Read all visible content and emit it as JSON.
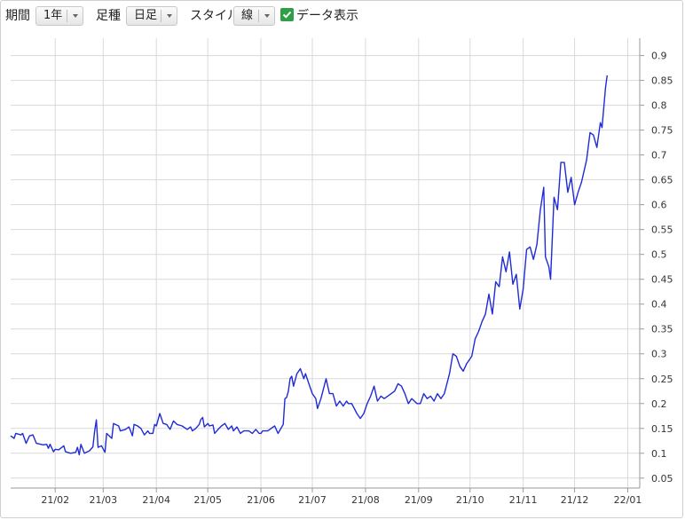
{
  "toolbar": {
    "period_label": "期間",
    "period_value": "1年",
    "candle_label": "足種",
    "candle_value": "日足",
    "style_label": "スタイル",
    "style_value": "線",
    "data_label": "データ表示",
    "data_checked": true
  },
  "chart_data": {
    "type": "line",
    "title": "",
    "xlabel": "",
    "ylabel": "",
    "ylim": [
      0.03,
      0.935
    ],
    "y_ticks": [
      "0.05",
      "0.1",
      "0.15",
      "0.2",
      "0.25",
      "0.3",
      "0.35",
      "0.4",
      "0.45",
      "0.5",
      "0.55",
      "0.6",
      "0.65",
      "0.7",
      "0.75",
      "0.8",
      "0.85",
      "0.9"
    ],
    "x_ticks": [
      {
        "label": "21/02",
        "date": "2021-02-01"
      },
      {
        "label": "21/03",
        "date": "2021-03-01"
      },
      {
        "label": "21/04",
        "date": "2021-04-01"
      },
      {
        "label": "21/05",
        "date": "2021-05-01"
      },
      {
        "label": "21/06",
        "date": "2021-06-01"
      },
      {
        "label": "21/07",
        "date": "2021-07-01"
      },
      {
        "label": "21/08",
        "date": "2021-08-01"
      },
      {
        "label": "21/09",
        "date": "2021-09-01"
      },
      {
        "label": "21/10",
        "date": "2021-10-01"
      },
      {
        "label": "21/11",
        "date": "2021-11-01"
      },
      {
        "label": "21/12",
        "date": "2021-12-01"
      },
      {
        "label": "22/01",
        "date": "2022-01-01"
      }
    ],
    "xlim": [
      "2021-01-06",
      "2022-01-08"
    ],
    "grid": true,
    "line_color": "#1f2bd6",
    "series": [
      {
        "points": [
          [
            "2021-01-06",
            0.135
          ],
          [
            "2021-01-08",
            0.13
          ],
          [
            "2021-01-09",
            0.14
          ],
          [
            "2021-01-12",
            0.137
          ],
          [
            "2021-01-13",
            0.14
          ],
          [
            "2021-01-15",
            0.12
          ],
          [
            "2021-01-17",
            0.135
          ],
          [
            "2021-01-19",
            0.137
          ],
          [
            "2021-01-21",
            0.12
          ],
          [
            "2021-01-25",
            0.117
          ],
          [
            "2021-01-27",
            0.118
          ],
          [
            "2021-01-28",
            0.11
          ],
          [
            "2021-01-29",
            0.118
          ],
          [
            "2021-01-31",
            0.103
          ],
          [
            "2021-02-01",
            0.108
          ],
          [
            "2021-02-03",
            0.107
          ],
          [
            "2021-02-06",
            0.115
          ],
          [
            "2021-02-07",
            0.103
          ],
          [
            "2021-02-10",
            0.1
          ],
          [
            "2021-02-13",
            0.102
          ],
          [
            "2021-02-14",
            0.112
          ],
          [
            "2021-02-15",
            0.097
          ],
          [
            "2021-02-16",
            0.118
          ],
          [
            "2021-02-18",
            0.1
          ],
          [
            "2021-02-21",
            0.105
          ],
          [
            "2021-02-23",
            0.113
          ],
          [
            "2021-02-24",
            0.145
          ],
          [
            "2021-02-25",
            0.167
          ],
          [
            "2021-02-26",
            0.112
          ],
          [
            "2021-02-28",
            0.115
          ],
          [
            "2021-03-02",
            0.102
          ],
          [
            "2021-03-03",
            0.14
          ],
          [
            "2021-03-06",
            0.13
          ],
          [
            "2021-03-07",
            0.16
          ],
          [
            "2021-03-10",
            0.155
          ],
          [
            "2021-03-11",
            0.145
          ],
          [
            "2021-03-14",
            0.148
          ],
          [
            "2021-03-16",
            0.153
          ],
          [
            "2021-03-17",
            0.145
          ],
          [
            "2021-03-18",
            0.135
          ],
          [
            "2021-03-19",
            0.158
          ],
          [
            "2021-03-21",
            0.155
          ],
          [
            "2021-03-23",
            0.15
          ],
          [
            "2021-03-25",
            0.137
          ],
          [
            "2021-03-27",
            0.145
          ],
          [
            "2021-03-28",
            0.14
          ],
          [
            "2021-03-30",
            0.14
          ],
          [
            "2021-03-31",
            0.158
          ],
          [
            "2021-04-01",
            0.155
          ],
          [
            "2021-04-03",
            0.18
          ],
          [
            "2021-04-05",
            0.16
          ],
          [
            "2021-04-07",
            0.158
          ],
          [
            "2021-04-09",
            0.148
          ],
          [
            "2021-04-11",
            0.165
          ],
          [
            "2021-04-13",
            0.158
          ],
          [
            "2021-04-16",
            0.155
          ],
          [
            "2021-04-19",
            0.148
          ],
          [
            "2021-04-21",
            0.153
          ],
          [
            "2021-04-22",
            0.145
          ],
          [
            "2021-04-24",
            0.15
          ],
          [
            "2021-04-26",
            0.158
          ],
          [
            "2021-04-27",
            0.168
          ],
          [
            "2021-04-28",
            0.172
          ],
          [
            "2021-04-29",
            0.153
          ],
          [
            "2021-05-01",
            0.16
          ],
          [
            "2021-05-02",
            0.155
          ],
          [
            "2021-05-04",
            0.157
          ],
          [
            "2021-05-05",
            0.14
          ],
          [
            "2021-05-07",
            0.148
          ],
          [
            "2021-05-09",
            0.155
          ],
          [
            "2021-05-11",
            0.16
          ],
          [
            "2021-05-13",
            0.148
          ],
          [
            "2021-05-15",
            0.155
          ],
          [
            "2021-05-16",
            0.145
          ],
          [
            "2021-05-18",
            0.153
          ],
          [
            "2021-05-20",
            0.14
          ],
          [
            "2021-05-22",
            0.145
          ],
          [
            "2021-05-25",
            0.145
          ],
          [
            "2021-05-27",
            0.14
          ],
          [
            "2021-05-29",
            0.148
          ],
          [
            "2021-05-31",
            0.14
          ],
          [
            "2021-06-01",
            0.14
          ],
          [
            "2021-06-02",
            0.145
          ],
          [
            "2021-06-05",
            0.145
          ],
          [
            "2021-06-07",
            0.15
          ],
          [
            "2021-06-09",
            0.155
          ],
          [
            "2021-06-11",
            0.14
          ],
          [
            "2021-06-14",
            0.158
          ],
          [
            "2021-06-15",
            0.21
          ],
          [
            "2021-06-16",
            0.212
          ],
          [
            "2021-06-17",
            0.225
          ],
          [
            "2021-06-18",
            0.25
          ],
          [
            "2021-06-19",
            0.255
          ],
          [
            "2021-06-20",
            0.235
          ],
          [
            "2021-06-22",
            0.26
          ],
          [
            "2021-06-24",
            0.27
          ],
          [
            "2021-06-26",
            0.25
          ],
          [
            "2021-06-27",
            0.26
          ],
          [
            "2021-06-29",
            0.24
          ],
          [
            "2021-07-01",
            0.22
          ],
          [
            "2021-07-03",
            0.21
          ],
          [
            "2021-07-04",
            0.19
          ],
          [
            "2021-07-06",
            0.21
          ],
          [
            "2021-07-09",
            0.25
          ],
          [
            "2021-07-11",
            0.22
          ],
          [
            "2021-07-13",
            0.22
          ],
          [
            "2021-07-15",
            0.195
          ],
          [
            "2021-07-17",
            0.205
          ],
          [
            "2021-07-19",
            0.195
          ],
          [
            "2021-07-21",
            0.205
          ],
          [
            "2021-07-22",
            0.2
          ],
          [
            "2021-07-24",
            0.2
          ],
          [
            "2021-07-27",
            0.18
          ],
          [
            "2021-07-29",
            0.17
          ],
          [
            "2021-07-31",
            0.18
          ],
          [
            "2021-08-02",
            0.2
          ],
          [
            "2021-08-04",
            0.215
          ],
          [
            "2021-08-06",
            0.235
          ],
          [
            "2021-08-08",
            0.205
          ],
          [
            "2021-08-10",
            0.215
          ],
          [
            "2021-08-12",
            0.21
          ],
          [
            "2021-08-14",
            0.215
          ],
          [
            "2021-08-16",
            0.22
          ],
          [
            "2021-08-18",
            0.225
          ],
          [
            "2021-08-20",
            0.24
          ],
          [
            "2021-08-22",
            0.235
          ],
          [
            "2021-08-24",
            0.22
          ],
          [
            "2021-08-26",
            0.2
          ],
          [
            "2021-08-28",
            0.21
          ],
          [
            "2021-08-31",
            0.2
          ],
          [
            "2021-09-02",
            0.2
          ],
          [
            "2021-09-04",
            0.22
          ],
          [
            "2021-09-06",
            0.21
          ],
          [
            "2021-09-08",
            0.215
          ],
          [
            "2021-09-10",
            0.205
          ],
          [
            "2021-09-12",
            0.22
          ],
          [
            "2021-09-14",
            0.21
          ],
          [
            "2021-09-16",
            0.22
          ],
          [
            "2021-09-19",
            0.26
          ],
          [
            "2021-09-21",
            0.3
          ],
          [
            "2021-09-23",
            0.295
          ],
          [
            "2021-09-25",
            0.275
          ],
          [
            "2021-09-27",
            0.265
          ],
          [
            "2021-09-29",
            0.28
          ],
          [
            "2021-10-02",
            0.295
          ],
          [
            "2021-10-04",
            0.33
          ],
          [
            "2021-10-06",
            0.345
          ],
          [
            "2021-10-08",
            0.365
          ],
          [
            "2021-10-10",
            0.38
          ],
          [
            "2021-10-12",
            0.42
          ],
          [
            "2021-10-14",
            0.38
          ],
          [
            "2021-10-16",
            0.445
          ],
          [
            "2021-10-18",
            0.435
          ],
          [
            "2021-10-20",
            0.495
          ],
          [
            "2021-10-22",
            0.465
          ],
          [
            "2021-10-24",
            0.505
          ],
          [
            "2021-10-26",
            0.44
          ],
          [
            "2021-10-28",
            0.46
          ],
          [
            "2021-10-30",
            0.39
          ],
          [
            "2021-11-01",
            0.43
          ],
          [
            "2021-11-03",
            0.51
          ],
          [
            "2021-11-05",
            0.515
          ],
          [
            "2021-11-07",
            0.49
          ],
          [
            "2021-11-09",
            0.52
          ],
          [
            "2021-11-11",
            0.59
          ],
          [
            "2021-11-13",
            0.635
          ],
          [
            "2021-11-14",
            0.495
          ],
          [
            "2021-11-16",
            0.475
          ],
          [
            "2021-11-17",
            0.45
          ],
          [
            "2021-11-19",
            0.615
          ],
          [
            "2021-11-21",
            0.59
          ],
          [
            "2021-11-23",
            0.685
          ],
          [
            "2021-11-25",
            0.685
          ],
          [
            "2021-11-27",
            0.625
          ],
          [
            "2021-11-29",
            0.655
          ],
          [
            "2021-12-01",
            0.6
          ],
          [
            "2021-12-03",
            0.625
          ],
          [
            "2021-12-05",
            0.645
          ],
          [
            "2021-12-08",
            0.69
          ],
          [
            "2021-12-10",
            0.745
          ],
          [
            "2021-12-12",
            0.74
          ],
          [
            "2021-12-14",
            0.715
          ],
          [
            "2021-12-16",
            0.765
          ],
          [
            "2021-12-17",
            0.755
          ],
          [
            "2021-12-19",
            0.835
          ],
          [
            "2021-12-20",
            0.86
          ]
        ]
      }
    ]
  }
}
